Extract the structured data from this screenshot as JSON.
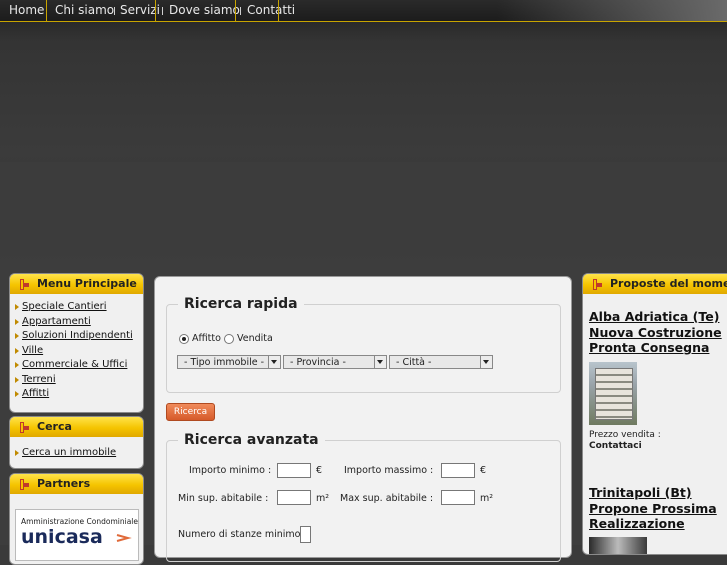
{
  "nav": {
    "items": [
      "Home",
      "Chi siamo",
      "Servizi",
      "Dove siamo",
      "Contatti"
    ]
  },
  "colors": {
    "accent_yellow": "#f5c400",
    "button_orange": "#e06a3a",
    "background_dark": "#3a3a3a"
  },
  "sidebar": {
    "menu": {
      "title": "Menu Principale",
      "items": [
        "Speciale Cantieri",
        "Appartamenti",
        "Soluzioni Indipendenti",
        "Ville",
        "Commerciale & Uffici",
        "Terreni",
        "Affitti"
      ]
    },
    "cerca": {
      "title": "Cerca",
      "items": [
        "Cerca un immobile"
      ]
    },
    "partners": {
      "title": "Partners",
      "banner_text_top": "Amministrazione Condominiale",
      "banner_text_brand": "unicasa"
    }
  },
  "ricerca_rapida": {
    "title": "Ricerca rapida",
    "radio_affitto": "Affitto",
    "radio_vendita": "Vendita",
    "selected": "Affitto",
    "select_tipo": "- Tipo immobile -",
    "select_provincia": "- Provincia -",
    "select_citta": "- Città -",
    "button": "Ricerca"
  },
  "ricerca_avanzata": {
    "title": "Ricerca avanzata",
    "importo_min_label": "Importo minimo :",
    "importo_max_label": "Importo massimo :",
    "euro_symbol": "€",
    "sup_min_label": "Min sup. abitabile :",
    "sup_max_label": "Max sup. abitabile :",
    "sqm_symbol": "m²",
    "stanze_label": "Numero di stanze minimo :"
  },
  "proposte": {
    "title": "Proposte del mome",
    "items": [
      {
        "line1": "Alba Adriatica (Te)",
        "line2": "Nuova Costruzione",
        "line3": "Pronta Consegna",
        "price_label": "Prezzo vendita :",
        "price_value": "Contattaci"
      },
      {
        "line1": "Trinitapoli (Bt)",
        "line2": "Propone Prossima",
        "line3": "Realizzazione"
      }
    ]
  }
}
